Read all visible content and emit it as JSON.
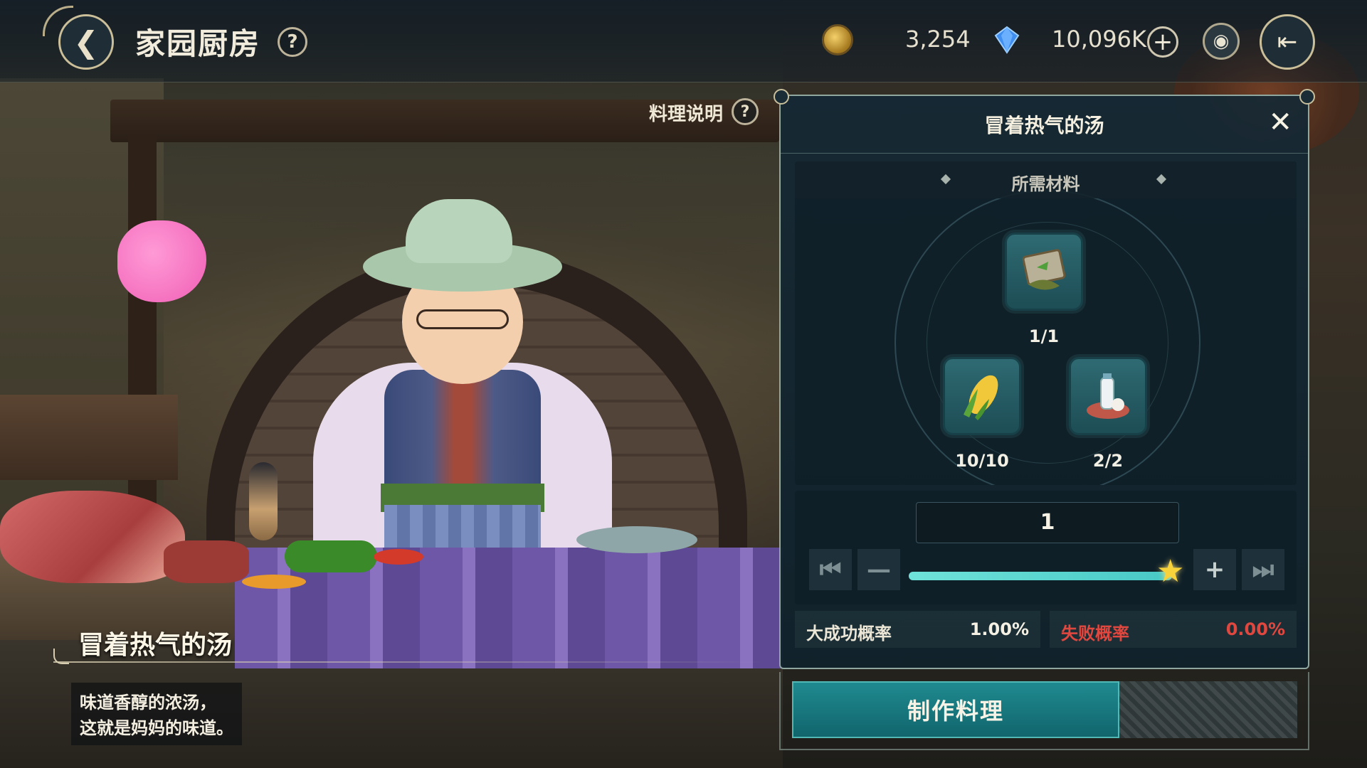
{
  "header": {
    "title": "家园厨房",
    "help_glyph": "?",
    "back_icon": "back-arrow-icon",
    "gold_amount": "3,254",
    "gem_amount": "10,096K",
    "plus_glyph": "+",
    "camera_icon": "camera-icon",
    "exit_icon": "exit-icon"
  },
  "cooking_explanation": {
    "label": "料理说明",
    "help_glyph": "?"
  },
  "dish": {
    "name": "冒着热气的汤",
    "description_lines": [
      "味道香醇的浓汤，",
      "这就是妈妈的味道。"
    ]
  },
  "recipe_panel": {
    "title": "冒着热气的汤",
    "close_glyph": "✕",
    "materials_title": "所需材料",
    "ingredients": [
      {
        "icon": "herb-packet-icon",
        "count": "1/1"
      },
      {
        "icon": "corn-icon",
        "count": "10/10"
      },
      {
        "icon": "milk-bottle-icon",
        "count": "2/2"
      }
    ],
    "quantity": "1",
    "slider_fraction": 1.0,
    "buttons": {
      "first_glyph": "⏮",
      "minus_glyph": "—",
      "plus_glyph": "+",
      "last_glyph": "⏭"
    },
    "great_success_label": "大成功概率",
    "great_success_value": "1.00%",
    "fail_label": "失败概率",
    "fail_value": "0.00%",
    "make_button": "制作料理"
  },
  "colors": {
    "accent_teal": "#1f8a90",
    "fail_red": "#e0473f",
    "slider_fill": "#6fe3d9",
    "gold": "#f4d06a",
    "gem_blue": "#3f8ef0"
  }
}
